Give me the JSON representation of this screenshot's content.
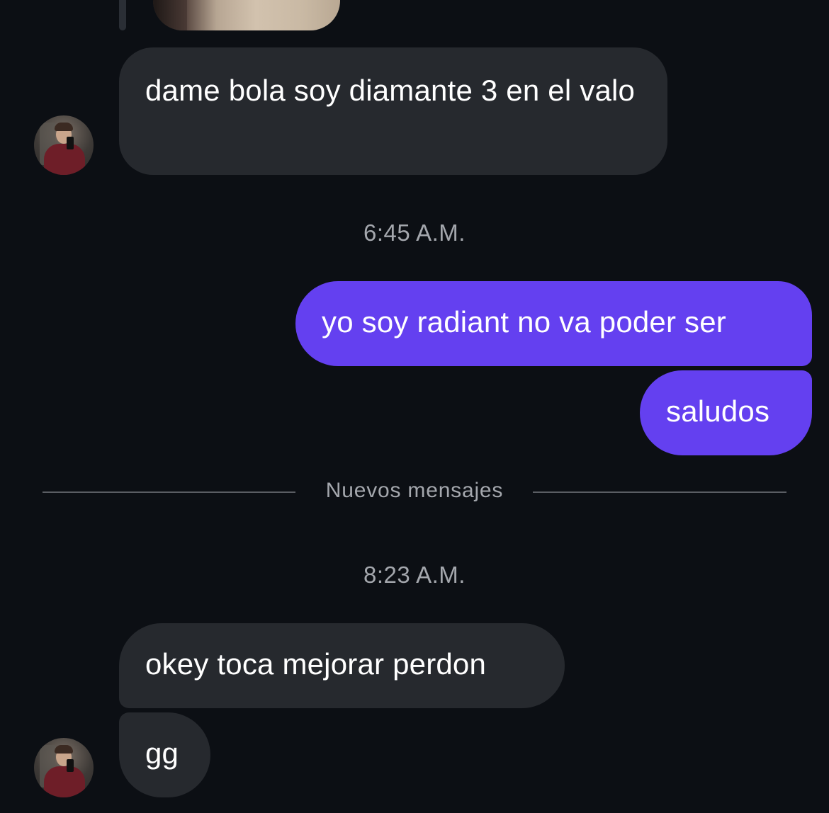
{
  "thread": {
    "messages": [
      {
        "id": "m1",
        "direction": "incoming",
        "text": "dame bola soy diamante 3 en el valo"
      },
      {
        "id": "m2",
        "direction": "outgoing",
        "text": "yo soy radiant no va poder ser"
      },
      {
        "id": "m3",
        "direction": "outgoing",
        "text": "saludos"
      },
      {
        "id": "m4",
        "direction": "incoming",
        "text": "okey toca mejorar perdon"
      },
      {
        "id": "m5",
        "direction": "incoming",
        "text": "gg"
      }
    ],
    "timestamps": {
      "first": "6:45 A.M.",
      "second": "8:23 A.M."
    },
    "new_messages_divider": "Nuevos mensajes"
  },
  "colors": {
    "background": "#0c0f14",
    "incoming_bubble": "#26292e",
    "outgoing_bubble": "#6440f0",
    "meta_text": "#a4a7ad"
  }
}
